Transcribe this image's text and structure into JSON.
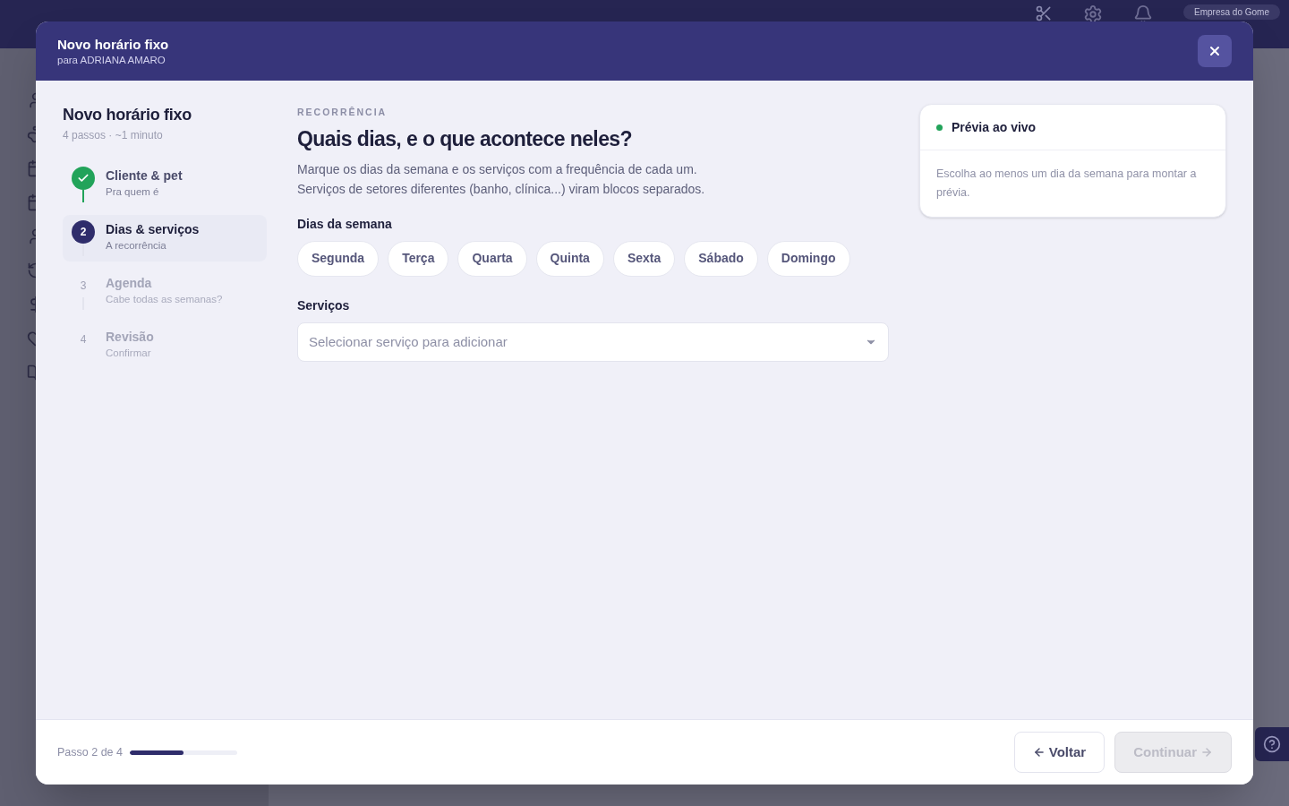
{
  "background": {
    "company": "Empresa do Gome"
  },
  "modal": {
    "title": "Novo horário fixo",
    "subtitle": "para ADRIANA AMARO"
  },
  "stepper": {
    "title": "Novo horário fixo",
    "meta": "4 passos · ~1 minuto",
    "steps": [
      {
        "kind": "done",
        "title": "Cliente & pet",
        "subtitle": "Pra quem é"
      },
      {
        "kind": "current",
        "number": "2",
        "title": "Dias & serviços",
        "subtitle": "A recorrência"
      },
      {
        "kind": "upcoming",
        "number": "3",
        "title": "Agenda",
        "subtitle": "Cabe todas as semanas?"
      },
      {
        "kind": "upcoming",
        "number": "4",
        "title": "Revisão",
        "subtitle": "Confirmar"
      }
    ]
  },
  "section": {
    "eyebrow": "RECORRÊNCIA",
    "heading": "Quais dias, e o que acontece neles?",
    "description": [
      "Marque os dias da semana e os serviços com a frequência de cada um.",
      "Serviços de setores diferentes (banho, clínica...) viram blocos separados."
    ],
    "days_label": "Dias da semana",
    "days": [
      {
        "label": "Segunda",
        "selected": false
      },
      {
        "label": "Terça",
        "selected": false
      },
      {
        "label": "Quarta",
        "selected": false
      },
      {
        "label": "Quinta",
        "selected": false
      },
      {
        "label": "Sexta",
        "selected": false
      },
      {
        "label": "Sábado",
        "selected": false
      },
      {
        "label": "Domingo",
        "selected": false
      }
    ],
    "services_label": "Serviços",
    "services_select": {
      "placeholder": "Selecionar serviço para adicionar"
    }
  },
  "preview": {
    "title": "Prévia ao vivo",
    "message": "Escolha ao menos um dia da semana para montar a prévia."
  },
  "footer": {
    "progress_text": "Passo 2 de 4",
    "level": 0.5,
    "back_button": "Voltar",
    "continue_button": {
      "label": "Continuar",
      "disabled": true
    }
  }
}
